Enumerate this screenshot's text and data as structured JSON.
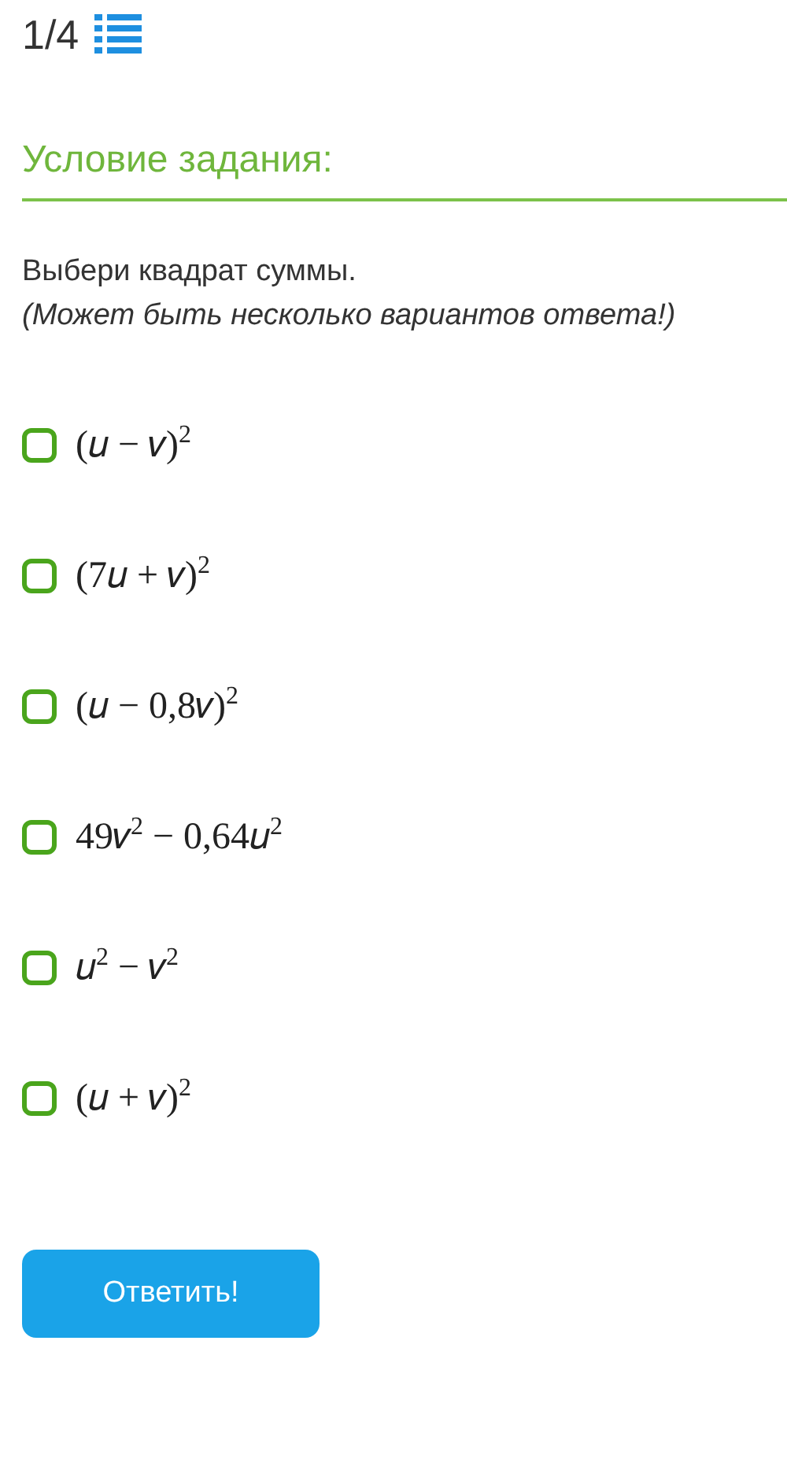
{
  "header": {
    "counter": "1/4"
  },
  "section_title": "Условие задания:",
  "question": "Выбери квадрат суммы.",
  "hint": "(Может быть несколько вариантов ответа!)",
  "options": [
    {
      "text": "(𝑢 − 𝑣)$^{2}$",
      "checked": false
    },
    {
      "text": "(7𝑢 + 𝑣)$^{2}$",
      "checked": false
    },
    {
      "text": "(𝑢 − 0,8𝑣)$^{2}$",
      "checked": false
    },
    {
      "text": "49𝑣$^{2}$ − 0,64𝑢$^{2}$",
      "checked": false
    },
    {
      "text": "𝑢$^{2}$ − 𝑣$^{2}$",
      "checked": false
    },
    {
      "text": "(𝑢 + 𝑣)$^{2}$",
      "checked": false
    }
  ],
  "submit_button": "Ответить!"
}
